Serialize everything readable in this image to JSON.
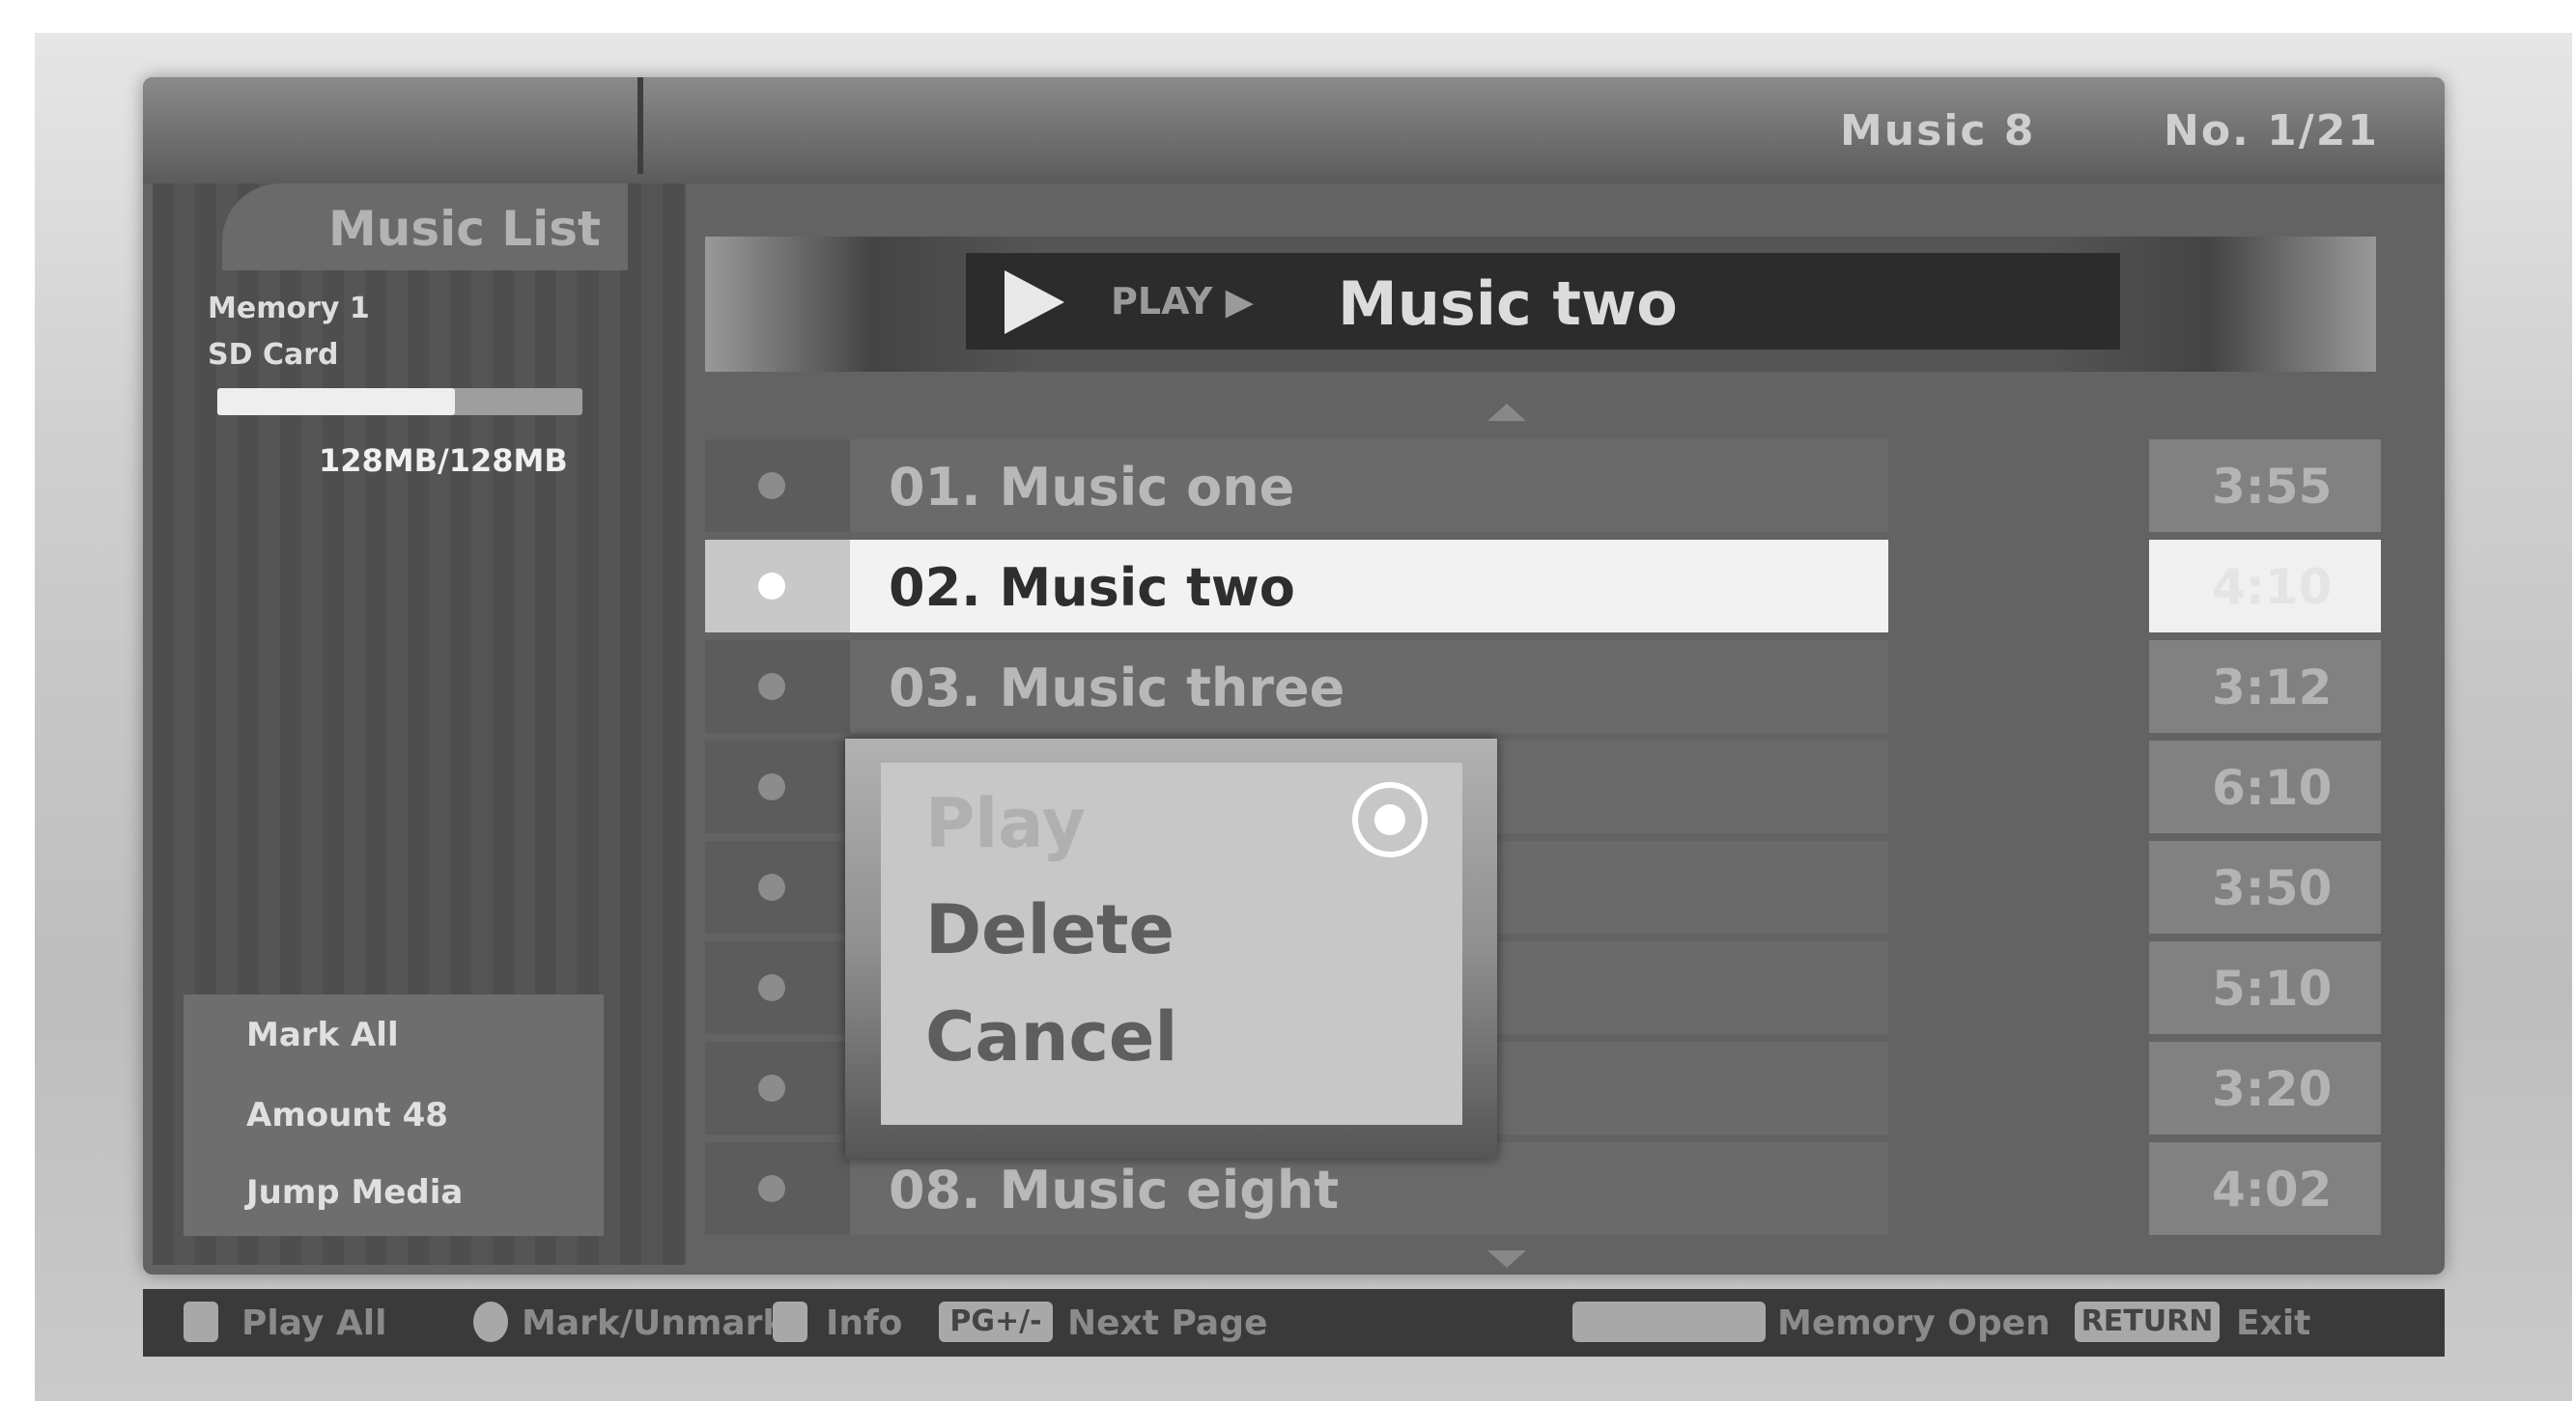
{
  "header": {
    "status_left": "Music 8",
    "status_right": "No. 1/21"
  },
  "sidebar": {
    "title": "Music List",
    "memory_label": "Memory 1",
    "card_label": "SD Card",
    "memory_used_fraction": 0.65,
    "memory_size": "128MB/128MB",
    "info": {
      "mark": "Mark All",
      "amount": "Amount 48",
      "jump": "Jump Media"
    }
  },
  "now_playing": {
    "tag": "PLAY ▶",
    "title": "Music two"
  },
  "tracks": [
    {
      "title": "01. Music one",
      "time": "3:55"
    },
    {
      "title": "02. Music two",
      "time": "4:10"
    },
    {
      "title": "03. Music three",
      "time": "3:12"
    },
    {
      "title": "",
      "time": "6:10"
    },
    {
      "title": "",
      "time": "3:50"
    },
    {
      "title": "",
      "time": "5:10"
    },
    {
      "title": "",
      "time": "3:20"
    },
    {
      "title": "08. Music eight",
      "time": "4:02"
    }
  ],
  "selected_track_index": 1,
  "popup_menu": {
    "items": [
      "Play",
      "Delete",
      "Cancel"
    ],
    "highlighted": "Play"
  },
  "footer": {
    "play_all": "Play All",
    "mark_unmark": "Mark/Unmark",
    "info": "Info",
    "page_key": "PG+/-",
    "next_page": "Next Page",
    "memory_open": "Memory Open",
    "exit_key": "RETURN",
    "exit": "Exit"
  }
}
